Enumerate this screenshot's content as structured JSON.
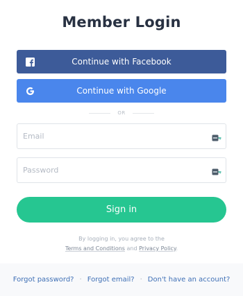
{
  "title": "Member Login",
  "social": {
    "facebook_label": "Continue with Facebook",
    "google_label": "Continue with Google",
    "facebook_color": "#3d5b99",
    "google_color": "#4a86ec"
  },
  "divider": {
    "label": "OR"
  },
  "form": {
    "email_placeholder": "Email",
    "email_value": "",
    "password_placeholder": "Password",
    "password_value": "",
    "field_icon": "password-manager-key-icon"
  },
  "signin": {
    "label": "Sign in",
    "color": "#26c691"
  },
  "legal": {
    "line1": "By logging in, you agree to the",
    "terms_link": "Terms and Conditions",
    "and_text": " and ",
    "privacy_link": "Privacy Policy",
    "period": "."
  },
  "footer": {
    "forgot_password": "Forgot password?",
    "forgot_email": "Forgot email?",
    "no_account": "Don't have an account?",
    "separator": "·"
  }
}
